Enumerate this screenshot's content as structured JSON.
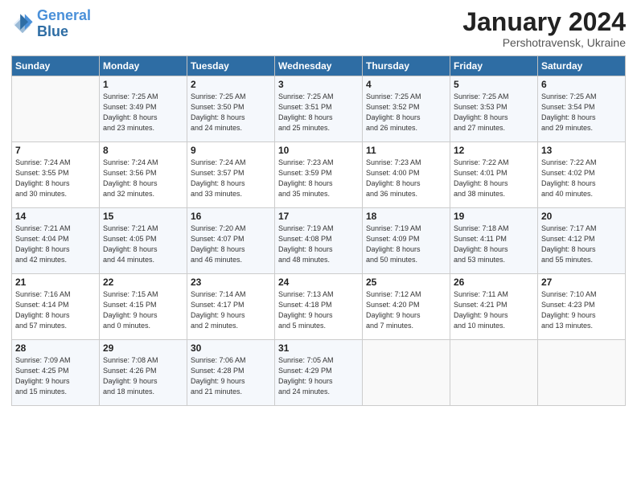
{
  "header": {
    "logo_line1": "General",
    "logo_line2": "Blue",
    "month": "January 2024",
    "location": "Pershotravensk, Ukraine"
  },
  "weekdays": [
    "Sunday",
    "Monday",
    "Tuesday",
    "Wednesday",
    "Thursday",
    "Friday",
    "Saturday"
  ],
  "weeks": [
    [
      {
        "day": "",
        "info": ""
      },
      {
        "day": "1",
        "info": "Sunrise: 7:25 AM\nSunset: 3:49 PM\nDaylight: 8 hours\nand 23 minutes."
      },
      {
        "day": "2",
        "info": "Sunrise: 7:25 AM\nSunset: 3:50 PM\nDaylight: 8 hours\nand 24 minutes."
      },
      {
        "day": "3",
        "info": "Sunrise: 7:25 AM\nSunset: 3:51 PM\nDaylight: 8 hours\nand 25 minutes."
      },
      {
        "day": "4",
        "info": "Sunrise: 7:25 AM\nSunset: 3:52 PM\nDaylight: 8 hours\nand 26 minutes."
      },
      {
        "day": "5",
        "info": "Sunrise: 7:25 AM\nSunset: 3:53 PM\nDaylight: 8 hours\nand 27 minutes."
      },
      {
        "day": "6",
        "info": "Sunrise: 7:25 AM\nSunset: 3:54 PM\nDaylight: 8 hours\nand 29 minutes."
      }
    ],
    [
      {
        "day": "7",
        "info": "Sunrise: 7:24 AM\nSunset: 3:55 PM\nDaylight: 8 hours\nand 30 minutes."
      },
      {
        "day": "8",
        "info": "Sunrise: 7:24 AM\nSunset: 3:56 PM\nDaylight: 8 hours\nand 32 minutes."
      },
      {
        "day": "9",
        "info": "Sunrise: 7:24 AM\nSunset: 3:57 PM\nDaylight: 8 hours\nand 33 minutes."
      },
      {
        "day": "10",
        "info": "Sunrise: 7:23 AM\nSunset: 3:59 PM\nDaylight: 8 hours\nand 35 minutes."
      },
      {
        "day": "11",
        "info": "Sunrise: 7:23 AM\nSunset: 4:00 PM\nDaylight: 8 hours\nand 36 minutes."
      },
      {
        "day": "12",
        "info": "Sunrise: 7:22 AM\nSunset: 4:01 PM\nDaylight: 8 hours\nand 38 minutes."
      },
      {
        "day": "13",
        "info": "Sunrise: 7:22 AM\nSunset: 4:02 PM\nDaylight: 8 hours\nand 40 minutes."
      }
    ],
    [
      {
        "day": "14",
        "info": "Sunrise: 7:21 AM\nSunset: 4:04 PM\nDaylight: 8 hours\nand 42 minutes."
      },
      {
        "day": "15",
        "info": "Sunrise: 7:21 AM\nSunset: 4:05 PM\nDaylight: 8 hours\nand 44 minutes."
      },
      {
        "day": "16",
        "info": "Sunrise: 7:20 AM\nSunset: 4:07 PM\nDaylight: 8 hours\nand 46 minutes."
      },
      {
        "day": "17",
        "info": "Sunrise: 7:19 AM\nSunset: 4:08 PM\nDaylight: 8 hours\nand 48 minutes."
      },
      {
        "day": "18",
        "info": "Sunrise: 7:19 AM\nSunset: 4:09 PM\nDaylight: 8 hours\nand 50 minutes."
      },
      {
        "day": "19",
        "info": "Sunrise: 7:18 AM\nSunset: 4:11 PM\nDaylight: 8 hours\nand 53 minutes."
      },
      {
        "day": "20",
        "info": "Sunrise: 7:17 AM\nSunset: 4:12 PM\nDaylight: 8 hours\nand 55 minutes."
      }
    ],
    [
      {
        "day": "21",
        "info": "Sunrise: 7:16 AM\nSunset: 4:14 PM\nDaylight: 8 hours\nand 57 minutes."
      },
      {
        "day": "22",
        "info": "Sunrise: 7:15 AM\nSunset: 4:15 PM\nDaylight: 9 hours\nand 0 minutes."
      },
      {
        "day": "23",
        "info": "Sunrise: 7:14 AM\nSunset: 4:17 PM\nDaylight: 9 hours\nand 2 minutes."
      },
      {
        "day": "24",
        "info": "Sunrise: 7:13 AM\nSunset: 4:18 PM\nDaylight: 9 hours\nand 5 minutes."
      },
      {
        "day": "25",
        "info": "Sunrise: 7:12 AM\nSunset: 4:20 PM\nDaylight: 9 hours\nand 7 minutes."
      },
      {
        "day": "26",
        "info": "Sunrise: 7:11 AM\nSunset: 4:21 PM\nDaylight: 9 hours\nand 10 minutes."
      },
      {
        "day": "27",
        "info": "Sunrise: 7:10 AM\nSunset: 4:23 PM\nDaylight: 9 hours\nand 13 minutes."
      }
    ],
    [
      {
        "day": "28",
        "info": "Sunrise: 7:09 AM\nSunset: 4:25 PM\nDaylight: 9 hours\nand 15 minutes."
      },
      {
        "day": "29",
        "info": "Sunrise: 7:08 AM\nSunset: 4:26 PM\nDaylight: 9 hours\nand 18 minutes."
      },
      {
        "day": "30",
        "info": "Sunrise: 7:06 AM\nSunset: 4:28 PM\nDaylight: 9 hours\nand 21 minutes."
      },
      {
        "day": "31",
        "info": "Sunrise: 7:05 AM\nSunset: 4:29 PM\nDaylight: 9 hours\nand 24 minutes."
      },
      {
        "day": "",
        "info": ""
      },
      {
        "day": "",
        "info": ""
      },
      {
        "day": "",
        "info": ""
      }
    ]
  ]
}
